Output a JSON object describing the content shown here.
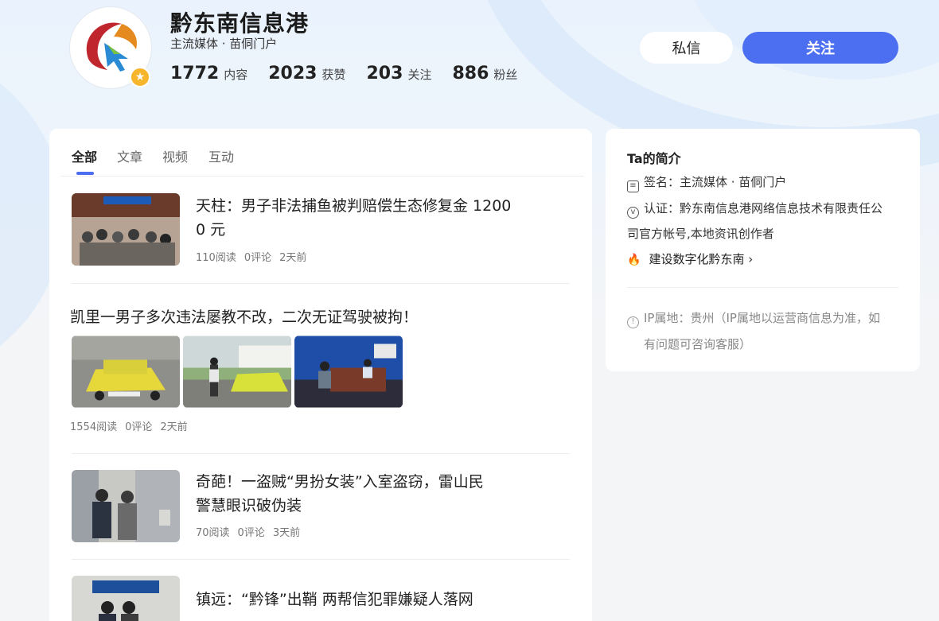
{
  "profile": {
    "name": "黔东南信息港",
    "subtitle": "主流媒体 · 苗侗门户",
    "stats": [
      {
        "num": "1772",
        "label": "内容"
      },
      {
        "num": "2023",
        "label": "获赞"
      },
      {
        "num": "203",
        "label": "关注"
      },
      {
        "num": "886",
        "label": "粉丝"
      }
    ],
    "message_label": "私信",
    "follow_label": "关注",
    "badge_icon": "star-icon",
    "accent": "#4c6ef0"
  },
  "tabs": [
    {
      "label": "全部",
      "active": true
    },
    {
      "label": "文章",
      "active": false
    },
    {
      "label": "视频",
      "active": false
    },
    {
      "label": "互动",
      "active": false
    }
  ],
  "feed": [
    {
      "title": "天柱：男子非法捕鱼被判赔偿生态修复金 12000 元",
      "title_line1": "天柱：男子非法捕鱼被判赔偿生态修复金 1200",
      "title_line2": "0 元",
      "reads": "110阅读",
      "comments": "0评论",
      "time": "2天前"
    },
    {
      "title": "凯里一男子多次违法屡教不改，二次无证驾驶被拘！",
      "reads": "1554阅读",
      "comments": "0评论",
      "time": "2天前"
    },
    {
      "title": "奇葩！一盗贼“男扮女装”入室盗窃，雷山民警慧眼识破伪装",
      "title_line1": "奇葩！一盗贼“男扮女装”入室盗窃，雷山民",
      "title_line2": "警慧眼识破伪装",
      "reads": "70阅读",
      "comments": "0评论",
      "time": "3天前"
    },
    {
      "title": "镇远：“黔锋”出鞘 两帮信犯罪嫌疑人落网"
    }
  ],
  "intro": {
    "title": "Ta的简介",
    "sign": "签名：主流媒体 · 苗侗门户",
    "cert_line1": "认证：黔东南信息港网络信息技术有限责任公",
    "cert_line2": "司官方帐号,本地资讯创作者",
    "link": "建设数字化黔东南",
    "ip_line1": "IP属地：贵州（IP属地以运营商信息为准，如",
    "ip_line2": "有问题可咨询客服）"
  }
}
